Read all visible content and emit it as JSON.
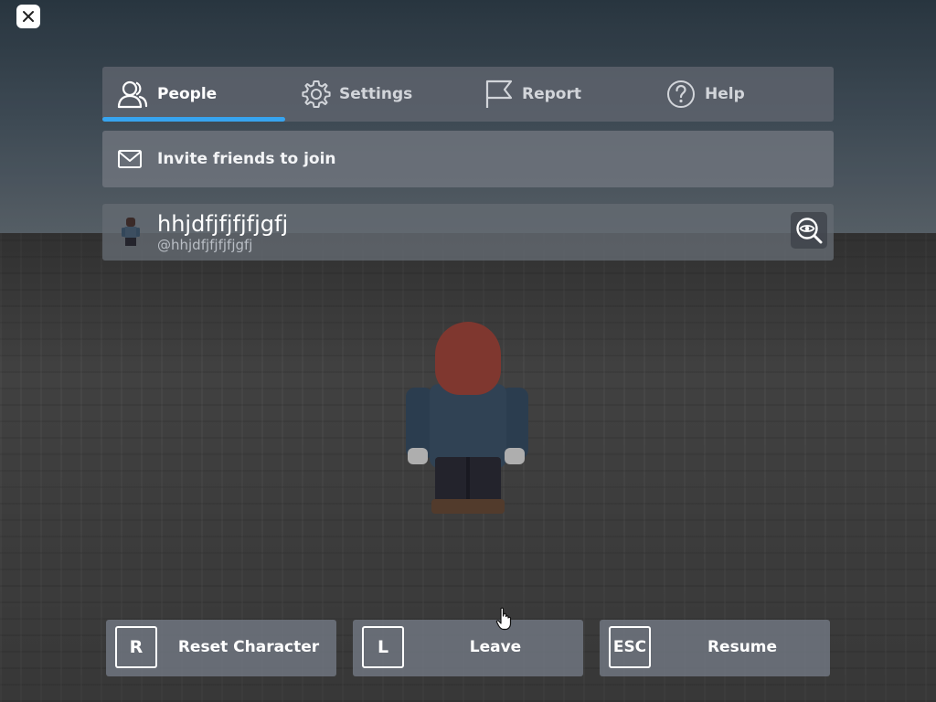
{
  "close_button": {
    "icon": "close-icon"
  },
  "tabs": [
    {
      "label": "People",
      "icon": "people-icon",
      "active": true
    },
    {
      "label": "Settings",
      "icon": "gear-icon",
      "active": false
    },
    {
      "label": "Report",
      "icon": "flag-icon",
      "active": false
    },
    {
      "label": "Help",
      "icon": "help-icon",
      "active": false
    }
  ],
  "invite": {
    "label": "Invite friends to join",
    "icon": "mail-icon"
  },
  "player": {
    "display_name": "hhjdfjfjfjfjgfj",
    "username": "@hhjdfjfjfjfjgfj",
    "view_icon": "view-avatar-icon"
  },
  "actions": [
    {
      "key": "R",
      "label": "Reset Character"
    },
    {
      "key": "L",
      "label": "Leave"
    },
    {
      "key": "ESC",
      "label": "Resume"
    }
  ],
  "colors": {
    "tab_accent": "#37a4ef",
    "panel_bg": "#5f646e",
    "text_primary": "#ffffff",
    "text_secondary": "#b9bec5"
  }
}
